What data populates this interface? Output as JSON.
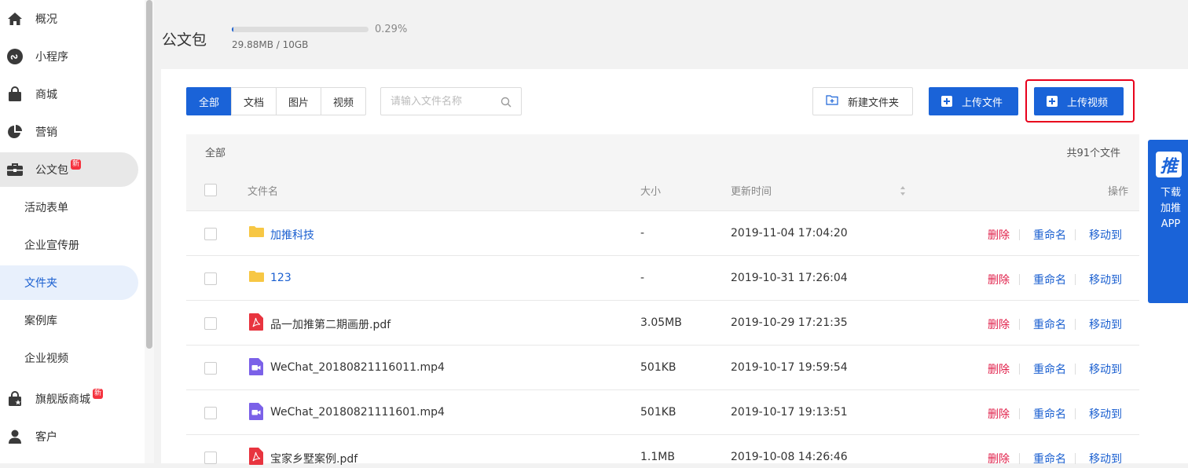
{
  "sidebar": {
    "items": [
      {
        "label": "概况",
        "icon": "home-icon"
      },
      {
        "label": "小程序",
        "icon": "mini-program-icon"
      },
      {
        "label": "商城",
        "icon": "shopping-bag-icon"
      },
      {
        "label": "营销",
        "icon": "pie-chart-icon"
      },
      {
        "label": "公文包",
        "icon": "briefcase-icon",
        "badge": "新",
        "active": true
      },
      {
        "label": "旗舰版商城",
        "icon": "flagship-store-icon",
        "badge": "新"
      },
      {
        "label": "客户",
        "icon": "user-icon"
      }
    ],
    "subitems": [
      {
        "label": "活动表单"
      },
      {
        "label": "企业宣传册"
      },
      {
        "label": "文件夹",
        "active": true
      },
      {
        "label": "案例库"
      },
      {
        "label": "企业视频"
      }
    ]
  },
  "header": {
    "title": "公文包",
    "quota_percent": "0.29%",
    "quota_fraction": 0.0029,
    "quota_used": "29.88MB / 10GB"
  },
  "toolbar": {
    "tabs": [
      "全部",
      "文档",
      "图片",
      "视频"
    ],
    "active_tab": "全部",
    "search_placeholder": "请输入文件名称",
    "new_folder_label": "新建文件夹",
    "upload_file_label": "上传文件",
    "upload_video_label": "上传视频"
  },
  "summary": {
    "breadcrumb": "全部",
    "count": "共91个文件"
  },
  "table": {
    "columns": {
      "name": "文件名",
      "size": "大小",
      "time": "更新时间",
      "actions": "操作"
    },
    "action_labels": {
      "delete": "删除",
      "rename": "重命名",
      "move": "移动到"
    },
    "rows": [
      {
        "name": "加推科技",
        "type": "folder",
        "size": "-",
        "time": "2019-11-04 17:04:20"
      },
      {
        "name": "123",
        "type": "folder",
        "size": "-",
        "time": "2019-10-31 17:26:04"
      },
      {
        "name": "品一加推第二期画册.pdf",
        "type": "pdf",
        "size": "3.05MB",
        "time": "2019-10-29 17:21:35"
      },
      {
        "name": "WeChat_20180821116011.mp4",
        "type": "video",
        "size": "501KB",
        "time": "2019-10-17 19:59:54"
      },
      {
        "name": "WeChat_20180821111601.mp4",
        "type": "video",
        "size": "501KB",
        "time": "2019-10-17 19:13:51"
      },
      {
        "name": "宝家乡墅案例.pdf",
        "type": "pdf",
        "size": "1.1MB",
        "time": "2019-10-08 14:26:46"
      }
    ]
  },
  "app_promo": {
    "logo_text": "推",
    "text": "下载加推APP"
  },
  "colors": {
    "primary": "#1a63d8",
    "danger": "#e0204a",
    "highlight": "#e8001c",
    "folder": "#f7c744",
    "pdf": "#e8343f",
    "video": "#7b61e8"
  }
}
